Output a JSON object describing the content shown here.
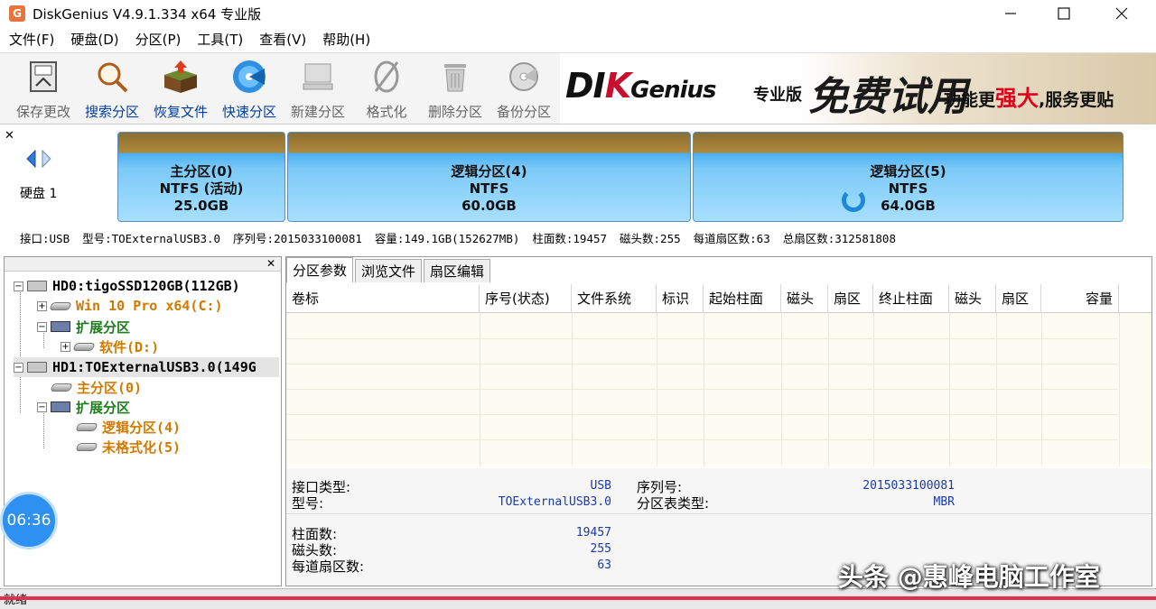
{
  "window": {
    "title": "DiskGenius V4.9.1.334 x64 专业版",
    "app_icon_letter": "G"
  },
  "menu": [
    "文件(F)",
    "硬盘(D)",
    "分区(P)",
    "工具(T)",
    "查看(V)",
    "帮助(H)"
  ],
  "toolbar": {
    "buttons": [
      {
        "label": "保存更改",
        "icon": "save-icon",
        "enabled": true
      },
      {
        "label": "搜索分区",
        "icon": "magnifier-icon",
        "enabled": true
      },
      {
        "label": "恢复文件",
        "icon": "recover-box-icon",
        "enabled": true
      },
      {
        "label": "快速分区",
        "icon": "quick-partition-disc-icon",
        "enabled": true
      },
      {
        "label": "新建分区",
        "icon": "new-partition-icon",
        "enabled": false
      },
      {
        "label": "格式化",
        "icon": "format-icon",
        "enabled": false
      },
      {
        "label": "删除分区",
        "icon": "trash-icon",
        "enabled": false
      },
      {
        "label": "备份分区",
        "icon": "backup-disc-icon",
        "enabled": false
      }
    ]
  },
  "banner": {
    "logo_left": "DI",
    "logo_k": "K",
    "logo_right": "Genius",
    "edition": "专业版",
    "promo": "免费试用",
    "slogan_a": "功能更",
    "slogan_strong": "强大",
    "slogan_b": ",服务更贴"
  },
  "disk_map": {
    "disk_label": "硬盘 1",
    "partitions": [
      {
        "name": "主分区(0)",
        "fs": "NTFS (活动)",
        "size": "25.0GB"
      },
      {
        "name": "逻辑分区(4)",
        "fs": "NTFS",
        "size": "60.0GB"
      },
      {
        "name": "逻辑分区(5)",
        "fs": "NTFS",
        "size": "64.0GB"
      }
    ],
    "info": {
      "interface": "接口:USB",
      "model": "型号:TOExternalUSB3.0",
      "serial": "序列号:2015033100081",
      "capacity": "容量:149.1GB(152627MB)",
      "cylinders": "柱面数:19457",
      "heads": "磁头数:255",
      "sectors_per_track": "每道扇区数:63",
      "total_sectors": "总扇区数:312581808"
    }
  },
  "tree": {
    "items": [
      {
        "label": "HD0:tigoSSD120GB(112GB)"
      },
      {
        "label": "Win 10 Pro x64(C:)"
      },
      {
        "label": "扩展分区"
      },
      {
        "label": "软件(D:)"
      },
      {
        "label": "HD1:TOExternalUSB3.0(149G"
      },
      {
        "label": "主分区(0)"
      },
      {
        "label": "扩展分区"
      },
      {
        "label": "逻辑分区(4)"
      },
      {
        "label": "未格式化(5)"
      }
    ]
  },
  "tabs": [
    "分区参数",
    "浏览文件",
    "扇区编辑"
  ],
  "grid": {
    "columns": [
      "卷标",
      "序号(状态)",
      "文件系统",
      "标识",
      "起始柱面",
      "磁头",
      "扇区",
      "终止柱面",
      "磁头",
      "扇区",
      "容量"
    ]
  },
  "details": {
    "interface_type_label": "接口类型:",
    "interface_type_value": "USB",
    "model_label": "型号:",
    "model_value": "TOExternalUSB3.0",
    "serial_label": "序列号:",
    "serial_value": "2015033100081",
    "pt_type_label": "分区表类型:",
    "pt_type_value": "MBR",
    "cylinders_label": "柱面数:",
    "cylinders_value": "19457",
    "heads_label": "磁头数:",
    "heads_value": "255",
    "spt_label": "每道扇区数:",
    "spt_value": "63"
  },
  "status": {
    "left": "就绪"
  },
  "overlay": {
    "timer": "06:36",
    "watermark": "头条 @惠峰电脑工作室"
  }
}
